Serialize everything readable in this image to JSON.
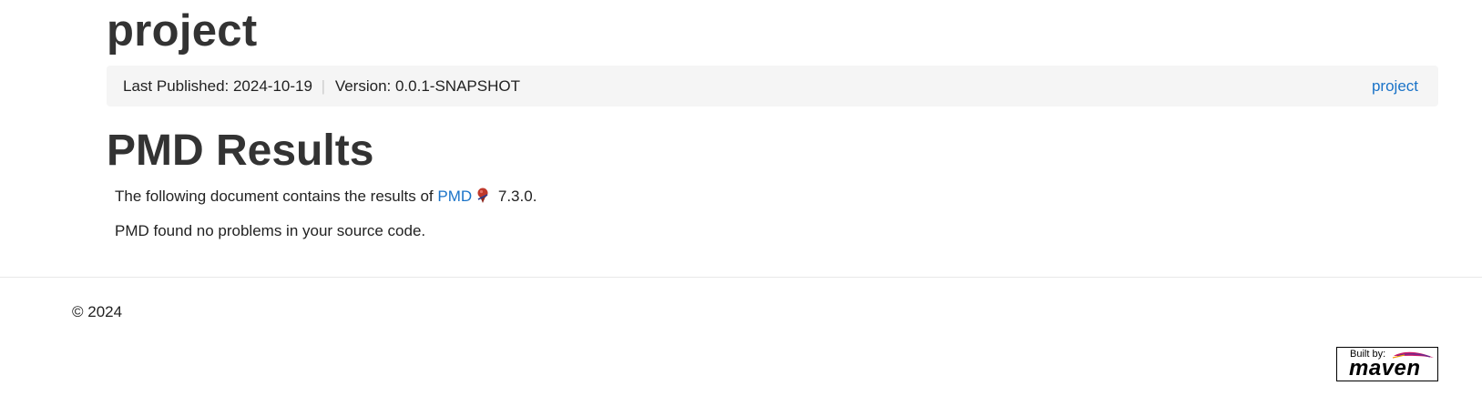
{
  "header": {
    "site_title": "project"
  },
  "breadcrumb": {
    "last_published": "Last Published: 2024-10-19",
    "divider": "|",
    "version": "Version: 0.0.1-SNAPSHOT",
    "project_link": "project"
  },
  "main": {
    "heading": "PMD Results",
    "intro_before": "The following document contains the results of ",
    "pmd_link": "PMD",
    "pmd_icon": "external-link-icon",
    "intro_after": " 7.3.0.",
    "summary": "PMD found no problems in your source code."
  },
  "footer": {
    "copyright": "© 2024",
    "badge_built_by": "Built by:",
    "badge_word": "maven",
    "badge_icon": "maven-feather-icon"
  },
  "colors": {
    "link": "#1a73c8",
    "breadcrumb_bg": "#f5f5f5",
    "text": "#333333"
  }
}
